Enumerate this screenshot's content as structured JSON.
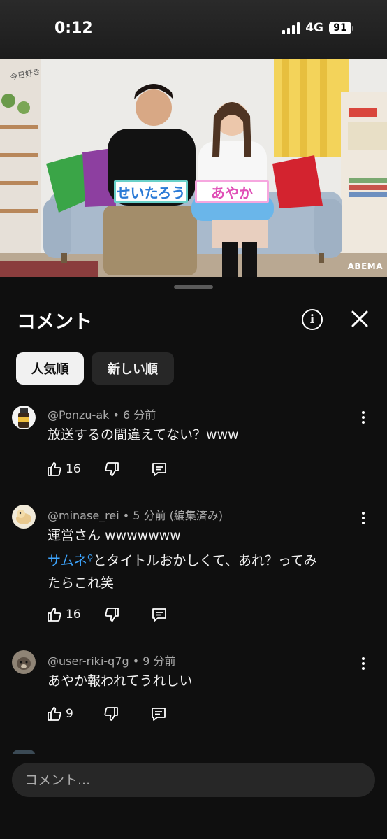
{
  "status_bar": {
    "time": "0:12",
    "network": "4G",
    "battery": "91"
  },
  "video": {
    "overlay_logo": "今日好き",
    "name_tags": [
      "せいたろう",
      "あやか"
    ],
    "watermark": "ABEMA"
  },
  "panel": {
    "title": "コメント",
    "sort_chips": [
      "人気順",
      "新しい順"
    ]
  },
  "comments": [
    {
      "author": "@Ponzu-ak",
      "time": "6 分前",
      "text_lines": [
        "放送するの間違えてない？www"
      ],
      "likes": "16"
    },
    {
      "author": "@minase_rei",
      "time": "5 分前 (編集済み)",
      "text_line1": "運営さん wwwwwww",
      "link_text": "サムネ",
      "text_line2_rest": "とタイトルおかしくて、あれ？ってみ",
      "text_line3": "たらこれ笑",
      "likes": "16"
    },
    {
      "author": "@user-riki-q7g",
      "time": "9 分前",
      "text_lines": [
        "あやか報われてうれしい"
      ],
      "likes": "9"
    }
  ],
  "input": {
    "placeholder": "コメント..."
  },
  "colors": {
    "link": "#3ea6ff",
    "background": "#0f0f0f",
    "chip_active": "#f1f1f1"
  }
}
